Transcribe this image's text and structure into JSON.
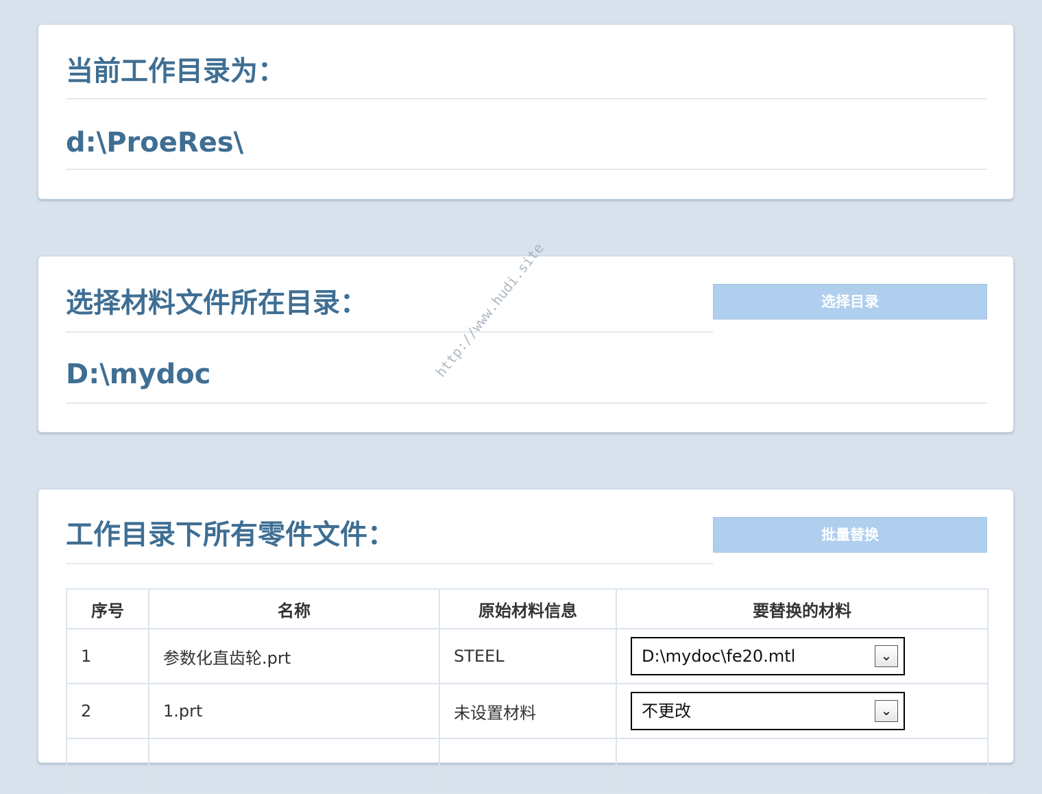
{
  "workdir": {
    "heading": "当前工作目录为：",
    "path": "d:\\ProeRes\\"
  },
  "material_dir": {
    "heading": "选择材料文件所在目录：",
    "path": "D:\\mydoc",
    "button_label": "选择目录"
  },
  "parts": {
    "heading": "工作目录下所有零件文件：",
    "button_label": "批量替换",
    "columns": [
      "序号",
      "名称",
      "原始材料信息",
      "要替换的材料"
    ],
    "rows": [
      {
        "index": "1",
        "name": "参数化直齿轮.prt",
        "original": "STEEL",
        "replace": "D:\\mydoc\\fe20.mtl"
      },
      {
        "index": "2",
        "name": "1.prt",
        "original": "未设置材料",
        "replace": "不更改"
      }
    ]
  },
  "watermark": "http://www.hudi.site",
  "colors": {
    "background": "#d8e2ec",
    "heading": "#3f6e93",
    "button": "#b0cfee"
  }
}
